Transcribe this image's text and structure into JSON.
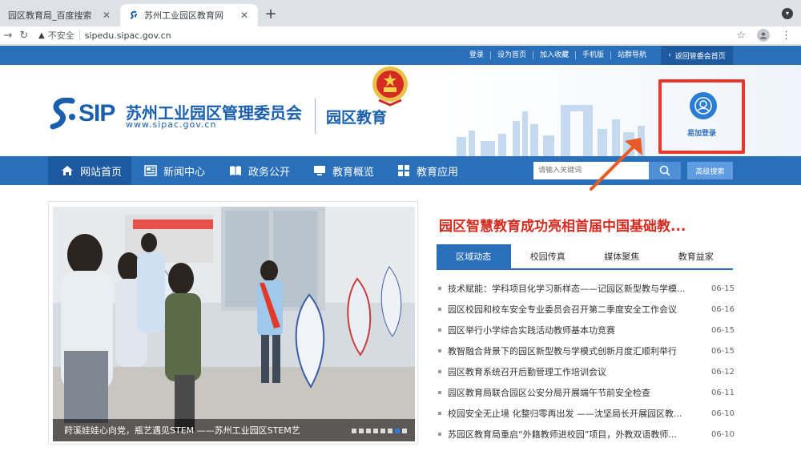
{
  "browser": {
    "tabs": [
      {
        "title": "园区教育局_百度搜索",
        "active": false
      },
      {
        "title": "苏州工业园区教育网",
        "active": true
      }
    ],
    "new_tab": "+",
    "security_label": "不安全",
    "url": "sipedu.sipac.gov.cn"
  },
  "topbar": {
    "links": [
      "登录",
      "设为首页",
      "加入收藏",
      "手机版",
      "站群导航"
    ],
    "back_link": "返回管委会首页"
  },
  "header": {
    "logo_text": "SIP",
    "org_name": "苏州工业园区管理委员会",
    "org_url": "www.sipac.gov.cn",
    "site_name": "园区教育",
    "login_label": "易加登录"
  },
  "nav": {
    "items": [
      {
        "label": "网站首页",
        "icon": "home-icon"
      },
      {
        "label": "新闻中心",
        "icon": "news-icon"
      },
      {
        "label": "政务公开",
        "icon": "book-icon"
      },
      {
        "label": "教育概览",
        "icon": "monitor-icon"
      },
      {
        "label": "教育应用",
        "icon": "apps-icon"
      }
    ],
    "search_placeholder": "请输入关键词",
    "advanced_search": "高级搜索"
  },
  "slideshow": {
    "caption": "莳溪娃娃心向党，瓶艺遇见STEM ——苏州工业园区STEM艺",
    "dot_count": 8,
    "active_dot": 7
  },
  "headline": "园区智慧教育成功亮相首届中国基础教...",
  "content_tabs": [
    "区域动态",
    "校园传真",
    "媒体聚焦",
    "教育益家"
  ],
  "news": [
    {
      "title": "技术赋能：学科项目化学习新样态——记园区新型教与学模...",
      "date": "06-15"
    },
    {
      "title": "园区校园和校车安全专业委员会召开第二季度安全工作会议",
      "date": "06-16"
    },
    {
      "title": "园区举行小学综合实践活动教师基本功竞赛",
      "date": "06-15"
    },
    {
      "title": "教智融合背景下的园区新型教与学模式创新月度汇顺利举行",
      "date": "06-15"
    },
    {
      "title": "园区教育系统召开后勤管理工作培训会议",
      "date": "06-12"
    },
    {
      "title": "园区教育局联合园区公安分局开展端午节前安全检查",
      "date": "06-11"
    },
    {
      "title": "校园安全无止境 化整归零再出发 ——沈坚局长开展园区教...",
      "date": "06-10"
    },
    {
      "title": "苏园区教育局重启“外籍教师进校园”项目，外教双语教师...",
      "date": "06-10"
    }
  ]
}
